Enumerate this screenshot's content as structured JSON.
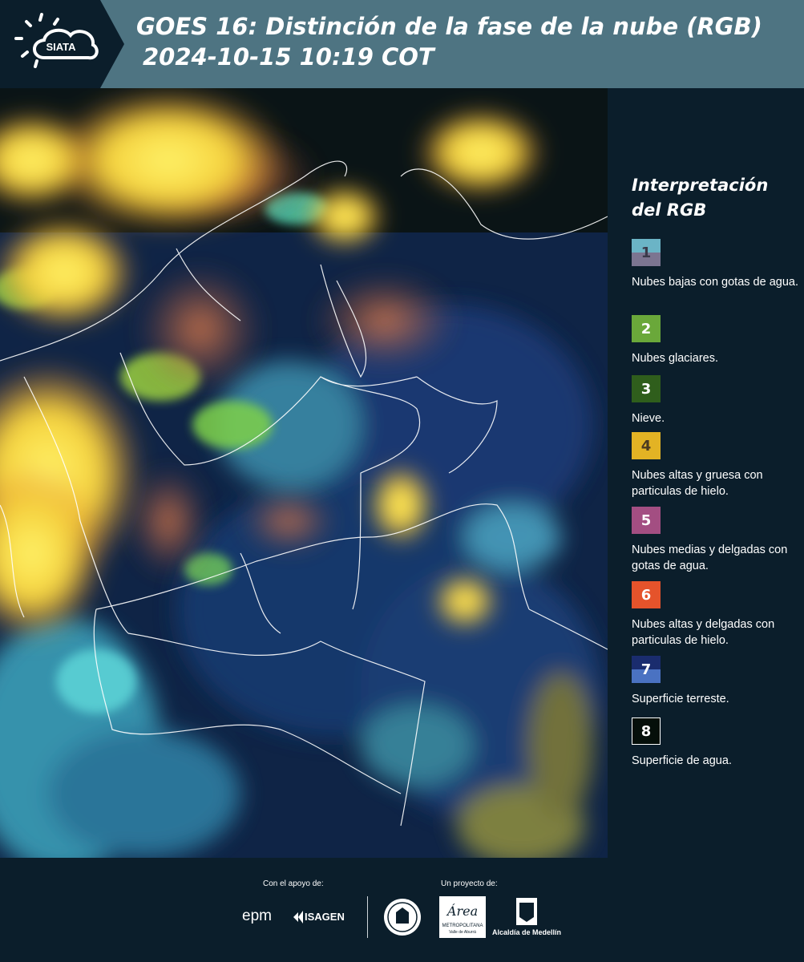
{
  "header": {
    "logo_text": "SIATA",
    "title_line1": "GOES 16: Distinción de la fase de la nube (RGB)",
    "title_line2": "2024-10-15 10:19 COT"
  },
  "legend": {
    "title_line1": "Interpretación",
    "title_line2": "del RGB",
    "items": [
      {
        "num": "1",
        "label": "Nubes bajas con gotas de agua.",
        "color_top": "#6bb4c6",
        "color_bottom": "#7c7591"
      },
      {
        "num": "2",
        "label": "Nubes glaciares.",
        "color": "#6aa83a"
      },
      {
        "num": "3",
        "label": "Nieve.",
        "color": "#2f5e1c"
      },
      {
        "num": "4",
        "label": "Nubes altas y gruesa con particulas de hielo.",
        "color": "#e3b324"
      },
      {
        "num": "5",
        "label": "Nubes medias y delgadas con gotas de agua.",
        "color": "#a34e82"
      },
      {
        "num": "6",
        "label": "Nubes altas y delgadas con particulas de hielo.",
        "color": "#e5532b"
      },
      {
        "num": "7",
        "label": "Superficie terreste.",
        "color_top": "#1a2c6e",
        "color_bottom": "#4a72c2"
      },
      {
        "num": "8",
        "label": "Superficie de agua.",
        "color": "#050f0a"
      }
    ]
  },
  "footer": {
    "support_label": "Con el apoyo de:",
    "project_label": "Un proyecto de:",
    "logos": {
      "epm": "epm",
      "isagen": "ISAGEN",
      "metropolitana_1": "Área",
      "metropolitana_2": "METROPOLITANA",
      "metropolitana_3": "Valle de Aburrá",
      "alcaldia": "Alcaldía de Medellín"
    }
  }
}
